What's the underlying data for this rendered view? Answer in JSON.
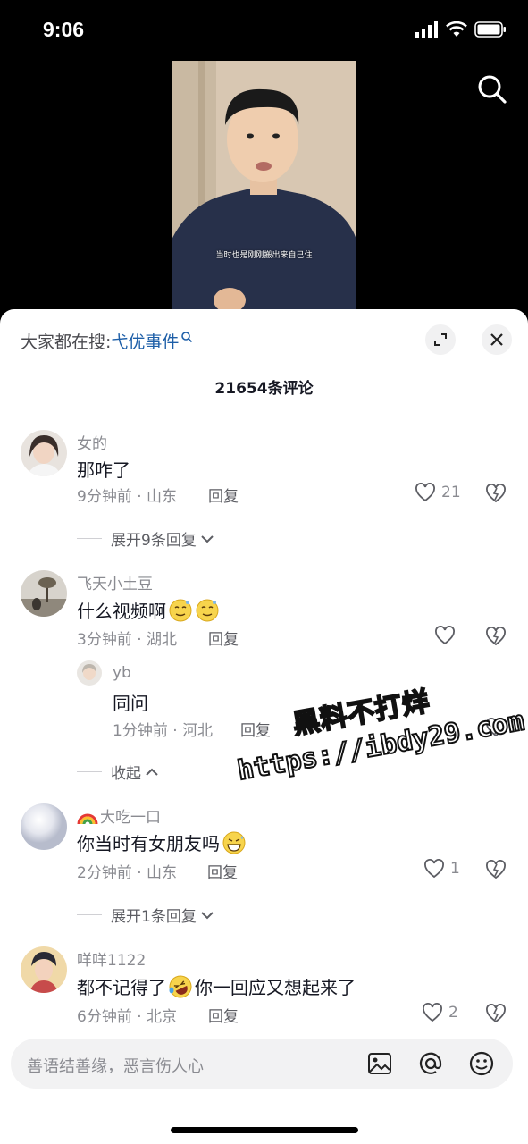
{
  "status": {
    "time": "9:06"
  },
  "video": {
    "subtitle": "当时也是刚刚搬出来自己住"
  },
  "header": {
    "hot_search_prefix": "大家都在搜:",
    "hot_search_term": "弋优事件",
    "comment_count": "21654条评论"
  },
  "comments": [
    {
      "username": "女的",
      "text": "那咋了",
      "meta": "9分钟前 · 山东",
      "reply": "回复",
      "likes": "21",
      "expand": "展开9条回复"
    },
    {
      "username": "飞天小土豆",
      "text": "什么视频啊",
      "meta": "3分钟前 · 湖北",
      "reply": "回复",
      "likes": "",
      "sub_reply": {
        "username": "yb",
        "text": "同问",
        "meta": "1分钟前 · 河北",
        "reply": "回复"
      },
      "collapse": "收起"
    },
    {
      "username": "大吃一口",
      "text": "你当时有女朋友吗",
      "meta": "2分钟前 · 山东",
      "reply": "回复",
      "likes": "1",
      "expand": "展开1条回复"
    },
    {
      "username": "咩咩1122",
      "text_before": "都不记得了",
      "text_after": "你一回应又想起来了",
      "meta": "6分钟前 · 北京",
      "reply": "回复",
      "likes": "2"
    }
  ],
  "input": {
    "placeholder": "善语结善缘，恶言伤人心"
  },
  "watermark": {
    "line1": "黑料不打烊",
    "line2": "https://ibdy29.com"
  },
  "colors": {
    "link": "#1e5fa8",
    "text": "#161823",
    "muted": "#8a8b91"
  }
}
